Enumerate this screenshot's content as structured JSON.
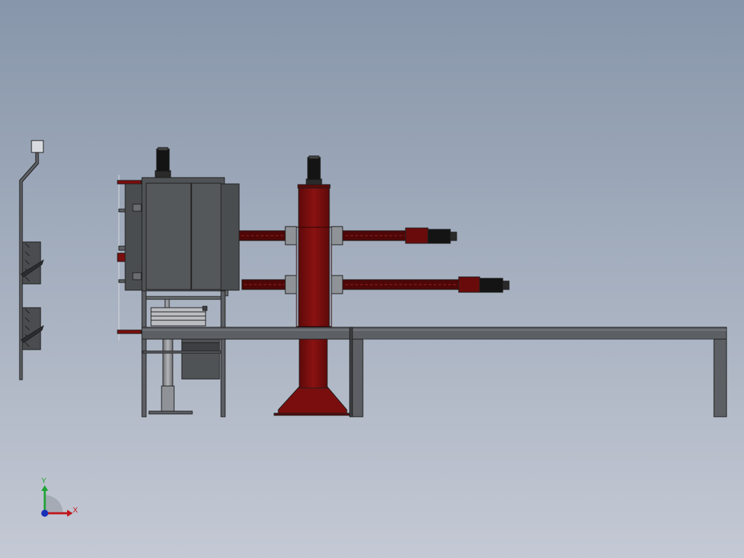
{
  "viewport": {
    "background_top": "#8796aa",
    "background_bottom": "#c4c9d4"
  },
  "colors": {
    "frame": "#5c5f63",
    "frame_dark": "#3d3f42",
    "frame_light": "#8a8d91",
    "cabinet": "#505356",
    "column": "#7a0e0e",
    "column_dark": "#4e0707",
    "rail": "#5a1010",
    "motor": "#141414",
    "outline": "#1e1e1e"
  },
  "triad": {
    "x_label": "X",
    "y_label": "Y",
    "x_color": "#c0151b",
    "y_color": "#1fa335",
    "z_color": "#1a2fb8"
  }
}
